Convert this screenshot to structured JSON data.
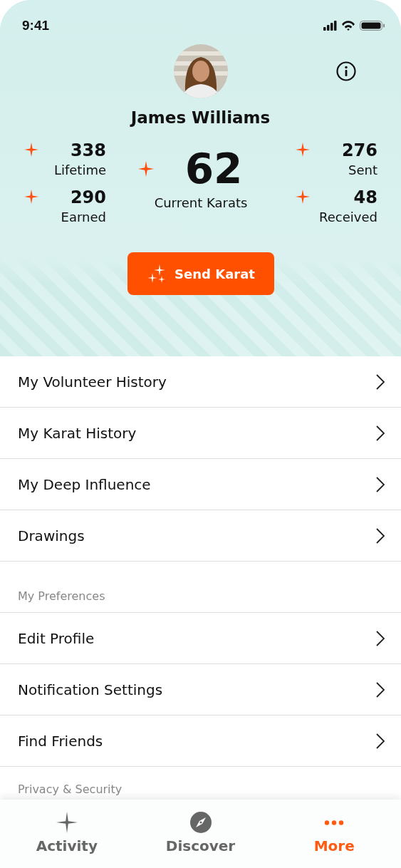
{
  "status_bar": {
    "time": "9:41"
  },
  "profile": {
    "name": "James Williams"
  },
  "stats_left": [
    {
      "value": "338",
      "label": "Lifetime"
    },
    {
      "value": "290",
      "label": "Earned"
    }
  ],
  "current": {
    "value": "62",
    "label": "Current Karats"
  },
  "stats_right": [
    {
      "value": "276",
      "label": "Sent"
    },
    {
      "value": "48",
      "label": "Received"
    }
  ],
  "send_button": {
    "label": "Send Karat"
  },
  "sections": [
    {
      "items": [
        "My Volunteer History",
        "My Karat History",
        "My Deep Influence",
        "Drawings"
      ]
    },
    {
      "header": "My Preferences",
      "items": [
        "Edit Profile",
        "Notification Settings",
        "Find Friends"
      ]
    },
    {
      "header": "Privacy & Security"
    }
  ],
  "tab_bar": [
    {
      "label": "Activity",
      "selected": false
    },
    {
      "label": "Discover",
      "selected": false
    },
    {
      "label": "More",
      "selected": true
    }
  ]
}
